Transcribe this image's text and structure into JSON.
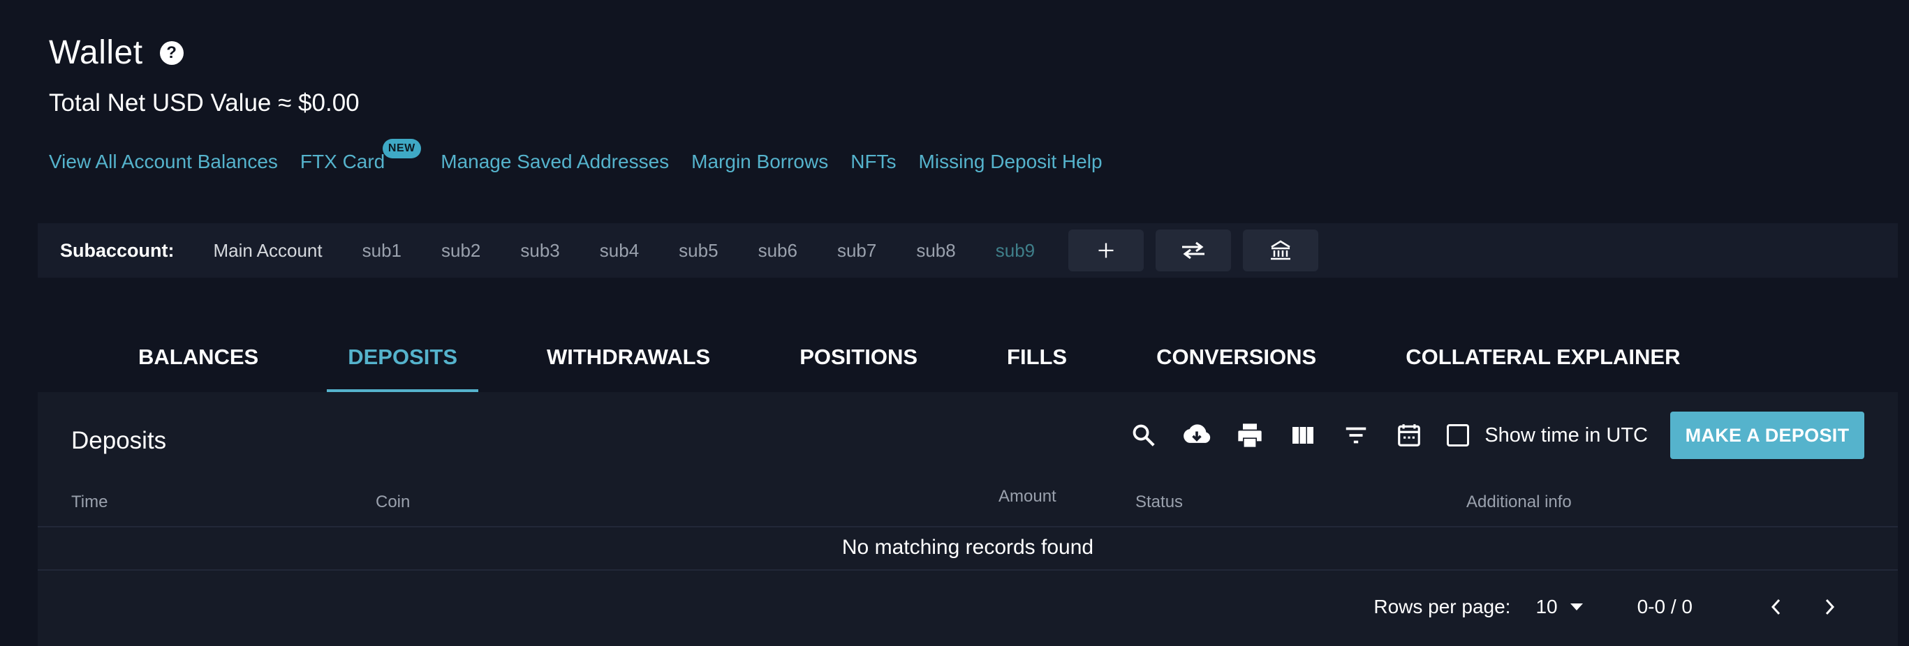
{
  "header": {
    "title": "Wallet",
    "help_glyph": "?",
    "net_value": "Total Net USD Value ≈ $0.00"
  },
  "links": {
    "view_balances": "View All Account Balances",
    "ftx_card": "FTX Card",
    "new_badge": "NEW",
    "saved_addresses": "Manage Saved Addresses",
    "margin_borrows": "Margin Borrows",
    "nfts": "NFTs",
    "deposit_help": "Missing Deposit Help"
  },
  "subaccount": {
    "label": "Subaccount:",
    "items": [
      "Main Account",
      "sub1",
      "sub2",
      "sub3",
      "sub4",
      "sub5",
      "sub6",
      "sub7",
      "sub8",
      "sub9"
    ],
    "buttons": [
      "plus-icon",
      "transfer-icon",
      "bank-icon"
    ]
  },
  "tabs": [
    "BALANCES",
    "DEPOSITS",
    "WITHDRAWALS",
    "POSITIONS",
    "FILLS",
    "CONVERSIONS",
    "COLLATERAL EXPLAINER"
  ],
  "panel": {
    "title": "Deposits",
    "toolbar_icons": [
      "search-icon",
      "download-icon",
      "print-icon",
      "columns-icon",
      "filter-icon",
      "calendar-icon"
    ],
    "utc_label": "Show time in UTC",
    "deposit_button": "MAKE A DEPOSIT",
    "columns": [
      "Time",
      "Coin",
      "Amount",
      "Status",
      "Additional info"
    ],
    "empty_message": "No matching records found",
    "rows_per_page_label": "Rows per page:",
    "rows_per_page": "10",
    "range": "0-0 / 0"
  },
  "colors": {
    "background": "#101420",
    "panel": "#161b27",
    "accent": "#55b3cc",
    "muted": "#9aa1ad"
  }
}
